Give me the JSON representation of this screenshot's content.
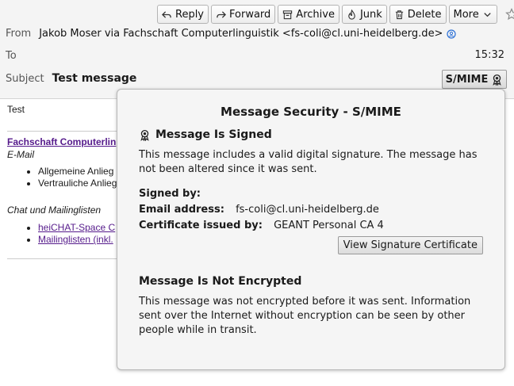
{
  "toolbar": {
    "reply": "Reply",
    "forward": "Forward",
    "archive": "Archive",
    "junk": "Junk",
    "delete": "Delete",
    "more": "More"
  },
  "header": {
    "from_label": "From",
    "from_value": "Jakob Moser via Fachschaft Computerlinguistik <fs-coli@cl.uni-heidelberg.de>",
    "to_label": "To",
    "time": "15:32",
    "subject_label": "Subject",
    "subject_value": "Test message",
    "smime_label": "S/MIME"
  },
  "body": {
    "greeting": "Test",
    "link_title": "Fachschaft Computerlin",
    "email_heading": "E-Mail",
    "email_items": [
      "Allgemeine Anlieg",
      "Vertrauliche Anlieg"
    ],
    "chat_heading": "Chat und Mailinglisten",
    "chat_items": [
      "heiCHAT-Space C",
      "Mailinglisten (inkl."
    ]
  },
  "popup": {
    "title": "Message Security - S/MIME",
    "signed_heading": "Message Is Signed",
    "signed_text": "This message includes a valid digital signature. The message has not been altered since it was sent.",
    "signed_by_label": "Signed by:",
    "email_label": "Email address:",
    "email_value": "fs-coli@cl.uni-heidelberg.de",
    "issuer_label": "Certificate issued by:",
    "issuer_value": "GEANT Personal CA 4",
    "view_cert_button": "View Signature Certificate",
    "encrypted_heading": "Message Is Not Encrypted",
    "encrypted_text": "This message was not encrypted before it was sent. Information sent over the Internet without encryption can be seen by other people while in transit."
  }
}
